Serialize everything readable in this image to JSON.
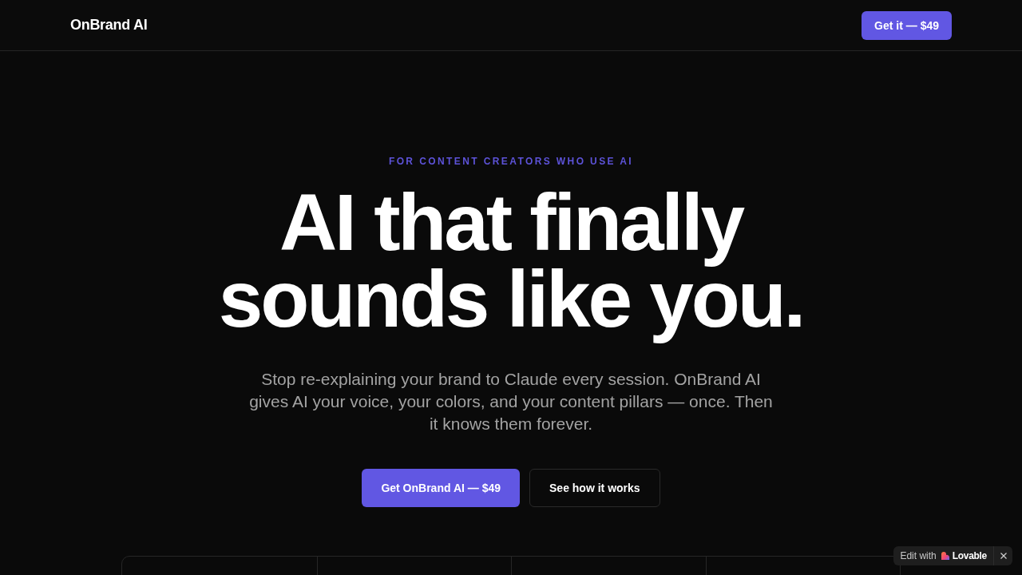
{
  "nav": {
    "brand": "OnBrand AI",
    "cta": "Get it — $49"
  },
  "hero": {
    "eyebrow": "FOR CONTENT CREATORS WHO USE AI",
    "headline_lines": [
      "AI that finally",
      "sounds like you."
    ],
    "description_lines": [
      "Stop re-explaining your brand to Claude every session. OnBrand AI",
      "gives AI your voice, your colors, and your content pillars — once. Then",
      "it knows them forever."
    ],
    "buttons": [
      {
        "kind": "primary",
        "label": "Get OnBrand AI — $49"
      },
      {
        "kind": "secondary",
        "label": "See how it works"
      }
    ]
  },
  "badge": {
    "prefix": "Edit with",
    "brand": "Lovable"
  }
}
